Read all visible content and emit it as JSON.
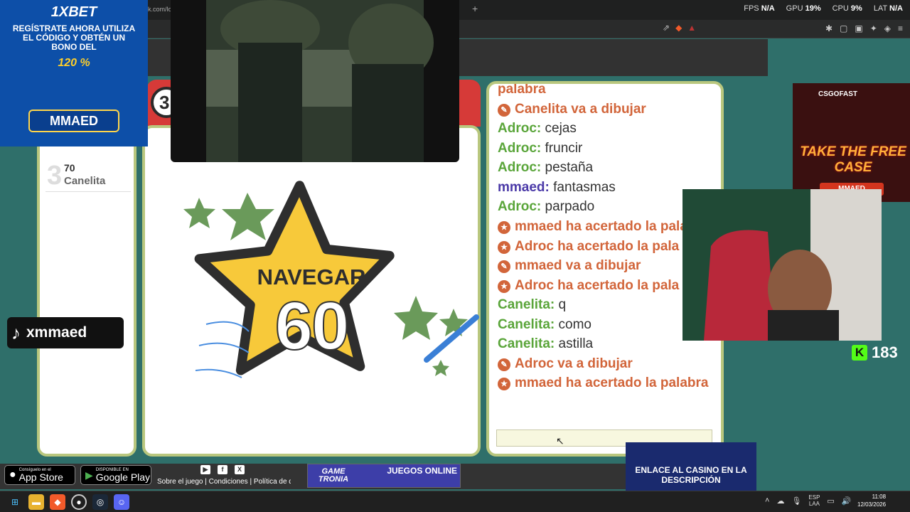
{
  "browser": {
    "tab_url": "k.com/lo",
    "new_tab_label": "+",
    "perf": {
      "fps_label": "FPS",
      "fps_value": "N/A",
      "gpu_label": "GPU",
      "gpu_value": "19%",
      "cpu_label": "CPU",
      "cpu_value": "9%",
      "lat_label": "LAT",
      "lat_value": "N/A"
    }
  },
  "game": {
    "round_number": "3",
    "ranking": [
      {
        "position": "3",
        "score": "70",
        "name": "Canelita"
      }
    ],
    "word": "NAVEGAR",
    "timer": "60"
  },
  "chat": {
    "messages": [
      {
        "type": "system",
        "icon": "draw-icon",
        "text": "palabra",
        "partial": true
      },
      {
        "type": "system",
        "icon": "draw-icon",
        "text": "Canelita va a dibujar"
      },
      {
        "type": "user",
        "user": "Adroc:",
        "text": "cejas",
        "color": "#5aa53a"
      },
      {
        "type": "user",
        "user": "Adroc:",
        "text": "fruncir",
        "color": "#5aa53a"
      },
      {
        "type": "user",
        "user": "Adroc:",
        "text": "pestaña",
        "color": "#5aa53a"
      },
      {
        "type": "user",
        "user": "mmaed:",
        "text": "fantasmas",
        "color": "#4b3aa8"
      },
      {
        "type": "user",
        "user": "Adroc:",
        "text": "parpado",
        "color": "#5aa53a"
      },
      {
        "type": "system",
        "icon": "star-icon",
        "text": "mmaed ha acertado la palabra",
        "wrap": true
      },
      {
        "type": "system",
        "icon": "star-icon",
        "text": "Adroc ha acertado la pala"
      },
      {
        "type": "system",
        "icon": "draw-icon",
        "text": "mmaed va a dibujar"
      },
      {
        "type": "system",
        "icon": "star-icon",
        "text": "Adroc ha acertado la pala"
      },
      {
        "type": "user",
        "user": "Canelita:",
        "text": "q",
        "color": "#5aa53a"
      },
      {
        "type": "user",
        "user": "Canelita:",
        "text": "como",
        "color": "#5aa53a"
      },
      {
        "type": "user",
        "user": "Canelita:",
        "text": "astilla",
        "color": "#5aa53a"
      },
      {
        "type": "system",
        "icon": "draw-icon",
        "text": "Adroc va a dibujar"
      },
      {
        "type": "system",
        "icon": "star-icon",
        "text": "mmaed ha acertado la palabra",
        "wrap": true
      }
    ]
  },
  "overlays": {
    "ad_1xbet": {
      "brand": "1XBET",
      "text": "REGÍSTRATE AHORA UTILIZA EL CÓDIGO Y OBTÉN UN BONO DEL",
      "amount": "120 %",
      "code": "MMAED"
    },
    "tiktok": {
      "handle": "xmmaed"
    },
    "ad_csgo": {
      "brand": "CSGOFAST",
      "title": "TAKE THE FREE CASE",
      "code": "MMAED"
    },
    "kick": {
      "viewers": "183"
    },
    "ad_casino": {
      "text": "ENLACE AL CASINO EN LA DESCRIPCIÓN"
    }
  },
  "footer": {
    "app_store": {
      "small": "Consíguelo en el",
      "big": "App Store"
    },
    "google_play": {
      "small": "DISPONIBLE EN",
      "big": "Google Play"
    },
    "links": "Sobre el juego | Condiciones | Política de dat",
    "gametronia": {
      "logo": "GAME TRONIA",
      "online": "JUEGOS ONLINE"
    }
  },
  "taskbar": {
    "lang": "ESP",
    "lang2": "LAA",
    "time": "11:08",
    "date": "12/03/2026"
  },
  "colors": {
    "accent_green": "#5aa53a",
    "system_orange": "#d2653a",
    "panel_border": "#b9c77e",
    "star_yellow": "#f7c93a"
  }
}
